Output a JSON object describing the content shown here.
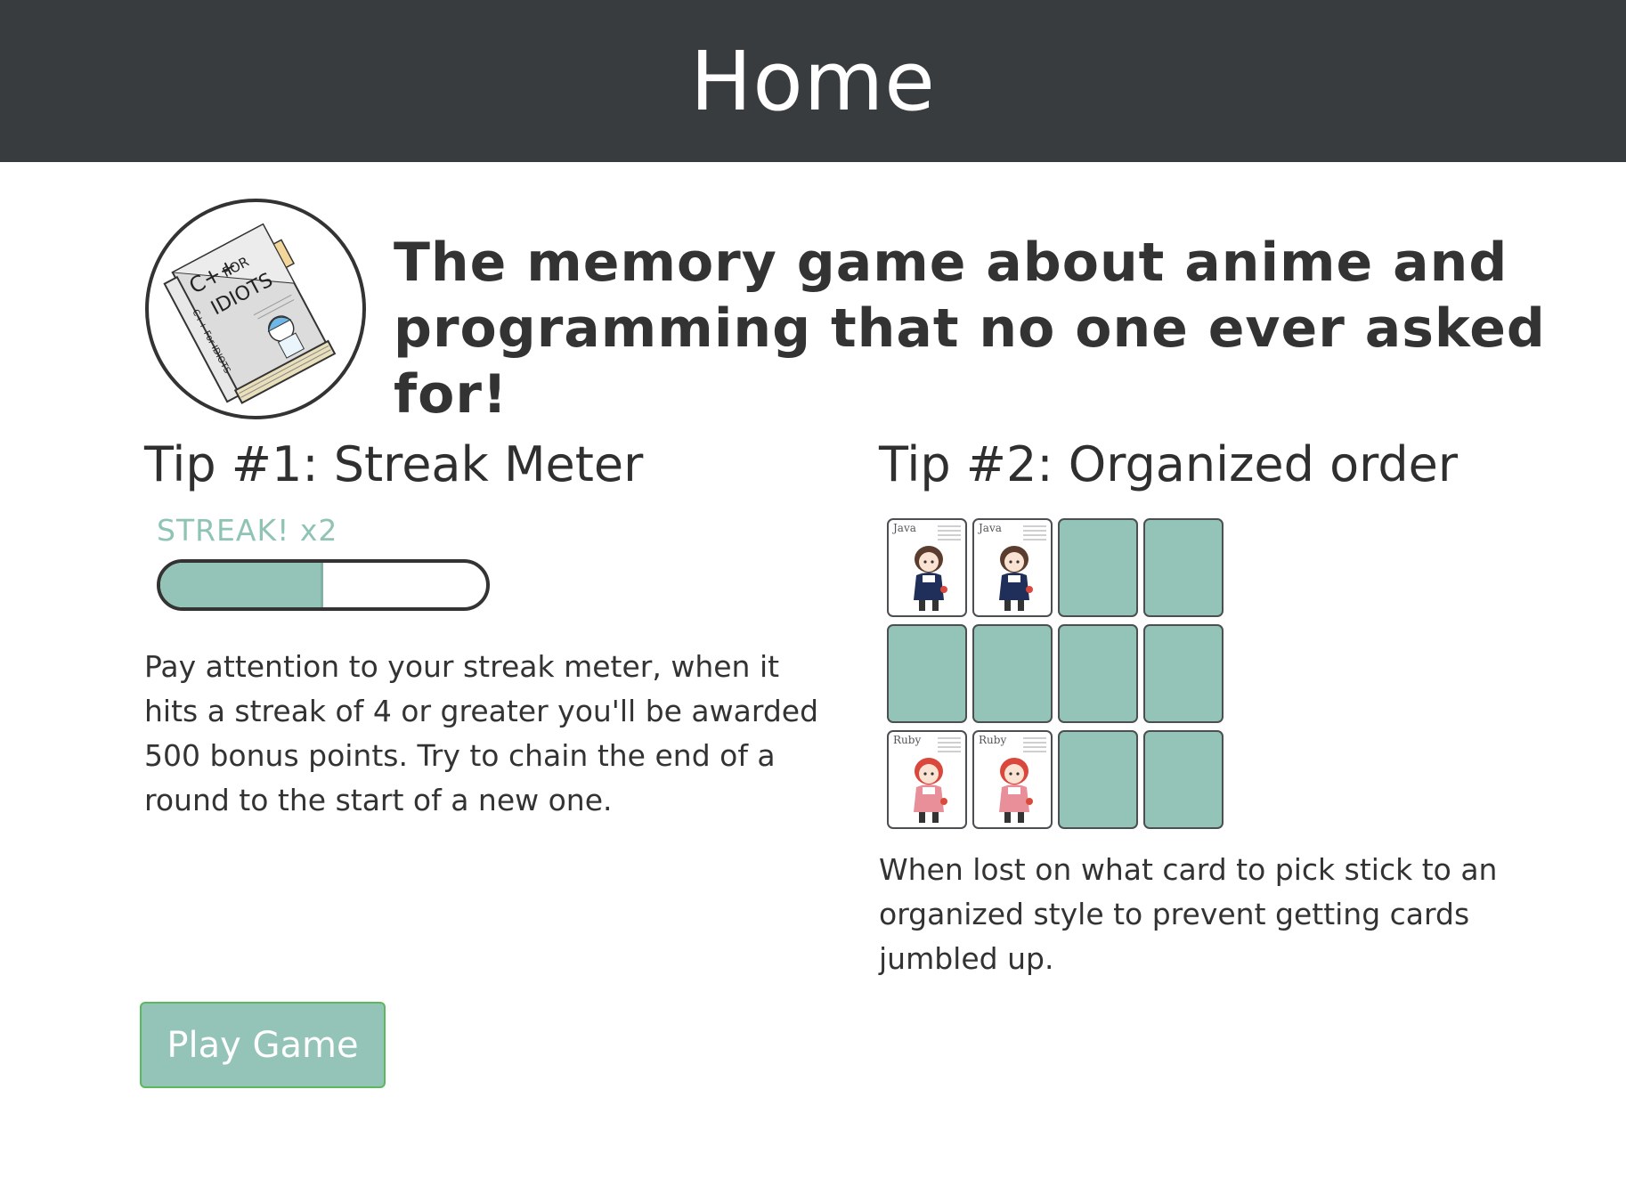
{
  "header": {
    "title": "Home"
  },
  "intro": {
    "tagline": "The memory game about anime and programming that no one ever asked for!",
    "logo": {
      "icon": "book-illustration-icon",
      "cover_text_top": "C++",
      "cover_text_for": "FOR",
      "cover_text_main": "IDIOTS",
      "spine_text": "C++ For IDIOTS"
    }
  },
  "tip1": {
    "title": "Tip #1: Streak Meter",
    "streak_label": "STREAK! x2",
    "streak_progress": 0.5,
    "text": "Pay attention to your streak meter, when it hits a streak of 4 or greater you'll be awarded 500 bonus points. Try to chain the end of a round to the start of a new one."
  },
  "tip2": {
    "title": "Tip #2: Organized order",
    "cards": [
      {
        "face": true,
        "label": "Java",
        "icon": "java-character-icon",
        "hair": "#5a3d2e",
        "outfit": "#1f2f5a"
      },
      {
        "face": true,
        "label": "Java",
        "icon": "java-character-icon",
        "hair": "#5a3d2e",
        "outfit": "#1f2f5a"
      },
      {
        "face": false
      },
      {
        "face": false
      },
      {
        "face": false
      },
      {
        "face": false
      },
      {
        "face": false
      },
      {
        "face": false
      },
      {
        "face": true,
        "label": "Ruby",
        "icon": "ruby-character-icon",
        "hair": "#d9473d",
        "outfit": "#e88f9a"
      },
      {
        "face": true,
        "label": "Ruby",
        "icon": "ruby-character-icon",
        "hair": "#d9473d",
        "outfit": "#e88f9a"
      },
      {
        "face": false
      },
      {
        "face": false
      }
    ],
    "text": "When lost on what card to pick stick to an organized style to prevent getting cards jumbled up."
  },
  "actions": {
    "play_label": "Play Game"
  },
  "colors": {
    "header_bg": "#393c3f",
    "accent": "#93c4b7",
    "button_border": "#5cb85c"
  }
}
